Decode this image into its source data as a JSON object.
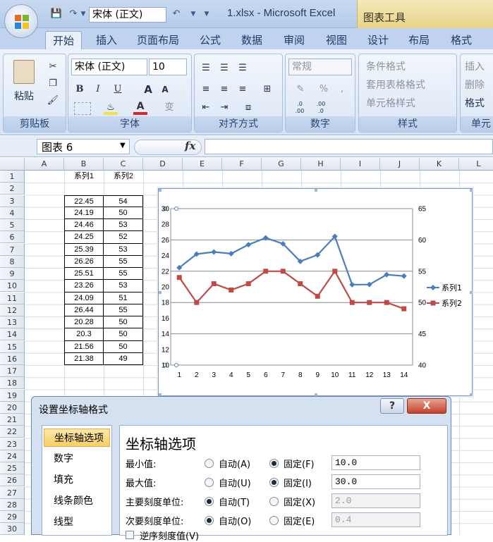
{
  "window": {
    "title": "1.xlsx - Microsoft Excel",
    "context_tab_group": "图表工具",
    "qat_font": "宋体 (正文)"
  },
  "tabs": [
    "开始",
    "插入",
    "页面布局",
    "公式",
    "数据",
    "审阅",
    "视图",
    "设计",
    "布局",
    "格式"
  ],
  "ribbon": {
    "clipboard": {
      "label": "剪贴板",
      "paste": "粘贴"
    },
    "font": {
      "label": "字体",
      "name": "宋体 (正文)",
      "size": "10",
      "bold": "B",
      "italic": "I",
      "underline": "U",
      "grow": "A",
      "shrink": "A",
      "phonetic": "变"
    },
    "alignment": {
      "label": "对齐方式"
    },
    "number": {
      "label": "数字",
      "format": "常规",
      "percent": "%",
      "comma": ",",
      "inc_decimal": ".0\n.00",
      "dec_decimal": ".00\n.0"
    },
    "styles": {
      "label": "样式",
      "conditional": "条件格式",
      "table": "套用表格格式",
      "cell": "单元格样式"
    },
    "cells": {
      "label": "单元",
      "insert": "插入",
      "delete": "删除",
      "format": "格式"
    }
  },
  "formula_bar": {
    "name_box": "图表 6",
    "fx": "fx",
    "formula": ""
  },
  "columns": [
    "A",
    "B",
    "C",
    "D",
    "E",
    "F",
    "G",
    "H",
    "I",
    "J",
    "K",
    "L"
  ],
  "rows": [
    "1",
    "2",
    "3",
    "4",
    "5",
    "6",
    "7",
    "8",
    "9",
    "10",
    "11",
    "12",
    "13",
    "14",
    "15",
    "16",
    "17",
    "18",
    "19",
    "20",
    "21",
    "22",
    "23",
    "24",
    "25",
    "26",
    "27",
    "28",
    "29",
    "30"
  ],
  "sheet": {
    "header_b": "系列1",
    "header_c": "系列2",
    "data": [
      [
        "22.45",
        "54"
      ],
      [
        "24.19",
        "50"
      ],
      [
        "24.46",
        "53"
      ],
      [
        "24.25",
        "52"
      ],
      [
        "25.39",
        "53"
      ],
      [
        "26.26",
        "55"
      ],
      [
        "25.51",
        "55"
      ],
      [
        "23.26",
        "53"
      ],
      [
        "24.09",
        "51"
      ],
      [
        "26.44",
        "55"
      ],
      [
        "20.28",
        "50"
      ],
      [
        "20.3",
        "50"
      ],
      [
        "21.56",
        "50"
      ],
      [
        "21.38",
        "49"
      ]
    ]
  },
  "chart_data": {
    "type": "line",
    "x": [
      1,
      2,
      3,
      4,
      5,
      6,
      7,
      8,
      9,
      10,
      11,
      12,
      13,
      14
    ],
    "series": [
      {
        "name": "系列1",
        "axis": "primary",
        "color": "#4a7ebb",
        "marker": "diamond",
        "values": [
          22.45,
          24.19,
          24.46,
          24.25,
          25.39,
          26.26,
          25.51,
          23.26,
          24.09,
          26.44,
          20.28,
          20.3,
          21.56,
          21.38
        ]
      },
      {
        "name": "系列2",
        "axis": "secondary",
        "color": "#be4b48",
        "marker": "square",
        "values": [
          54,
          50,
          53,
          52,
          53,
          55,
          55,
          53,
          51,
          55,
          50,
          50,
          50,
          49
        ]
      }
    ],
    "primary_y": {
      "min": 10,
      "max": 30,
      "step": 2,
      "ticks": [
        "10",
        "12",
        "14",
        "16",
        "18",
        "20",
        "22",
        "24",
        "26",
        "28",
        "30"
      ]
    },
    "secondary_y": {
      "min": 40,
      "max": 65,
      "step": 5,
      "ticks": [
        "40",
        "45",
        "50",
        "55",
        "60",
        "65"
      ]
    },
    "x_ticks": [
      "1",
      "2",
      "3",
      "4",
      "5",
      "6",
      "7",
      "8",
      "9",
      "10",
      "11",
      "12",
      "13",
      "14"
    ],
    "grid": true,
    "legend": "right"
  },
  "dialog": {
    "title": "设置坐标轴格式",
    "help": "?",
    "close": "X",
    "nav": [
      "坐标轴选项",
      "数字",
      "填充",
      "线条颜色",
      "线型"
    ],
    "panel_title": "坐标轴选项",
    "rows": [
      {
        "label": "最小值:",
        "auto": "自动(A)",
        "fixed": "固定(F)",
        "auto_on": false,
        "value": "10.0",
        "disabled": false
      },
      {
        "label": "最大值:",
        "auto": "自动(U)",
        "fixed": "固定(I)",
        "auto_on": false,
        "value": "30.0",
        "disabled": false
      },
      {
        "label": "主要刻度单位:",
        "auto": "自动(T)",
        "fixed": "固定(X)",
        "auto_on": true,
        "value": "2.0",
        "disabled": true
      },
      {
        "label": "次要刻度单位:",
        "auto": "自动(O)",
        "fixed": "固定(E)",
        "auto_on": true,
        "value": "0.4",
        "disabled": true
      }
    ],
    "partial_option": "逆序刻度值(V)"
  }
}
